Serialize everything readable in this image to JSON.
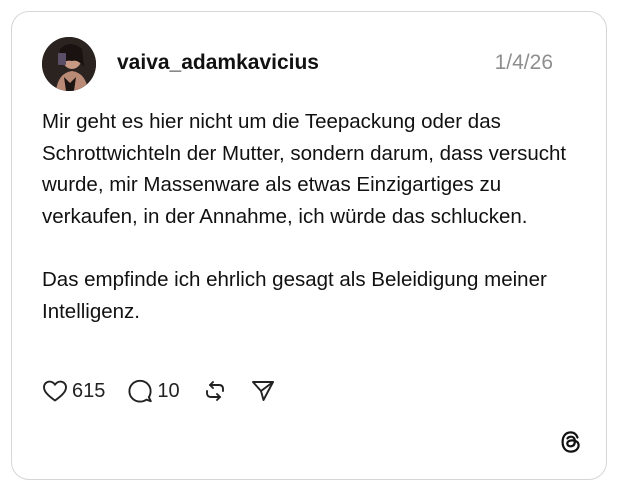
{
  "post": {
    "username": "vaiva_adamkavicius",
    "date": "1/4/26",
    "paragraphs": [
      "Mir geht es hier nicht um die Teepackung oder das Schrottwichteln der Mutter, sondern darum, dass versucht wurde, mir Massenware als etwas Einzigartiges zu verkaufen, in der Annahme, ich würde das schlucken.",
      "Das empfinde ich ehrlich gesagt als Beleidigung meiner Intelligenz."
    ],
    "likes": "615",
    "replies": "10"
  },
  "icons": {
    "avatar": "user-avatar-photo",
    "like": "heart-icon",
    "reply": "speech-bubble-icon",
    "repost": "repost-arrows-icon",
    "share": "paper-plane-icon",
    "brand": "threads-logo-icon"
  }
}
